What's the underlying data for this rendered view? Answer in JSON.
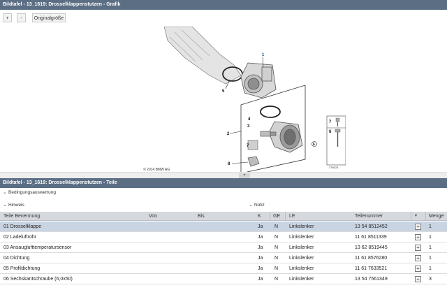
{
  "top_panel": {
    "title": "Bildtafel - 13_1619: Drosselklappenstutzen - Grafik"
  },
  "toolbar": {
    "zoom_in": "+",
    "zoom_out": "-",
    "original_size": "Originalgröße"
  },
  "figure": {
    "copyright": "© 2014 BMW AG",
    "image_number": "376023",
    "callouts": [
      "1",
      "2",
      "3",
      "4",
      "5",
      "6",
      "7",
      "8"
    ]
  },
  "bottom_panel": {
    "title": "Bildtafel - 13_1619: Drosselklappenstutzen - Teile"
  },
  "sections": {
    "conditions": "Bedingungsauswertung",
    "hint": "Hinweis",
    "note": "Notiz"
  },
  "table": {
    "headers": {
      "name": "Teile Benennung",
      "from": "Von",
      "to": "Bis",
      "k": "K",
      "ge": "GE",
      "le": "LE",
      "part_no": "Teilenummer",
      "qty": "Menge"
    },
    "rows": [
      {
        "name": "01 Drosselklappe",
        "k": "Ja",
        "ge": "N",
        "le": "Linkslenker",
        "part_no": "13 54 8512452",
        "qty": "1"
      },
      {
        "name": "02 Ladeluftrohr",
        "k": "Ja",
        "ge": "N",
        "le": "Linkslenker",
        "part_no": "11 61 8511339",
        "qty": "1"
      },
      {
        "name": "03 Ansauglufttemperatursensor",
        "k": "Ja",
        "ge": "N",
        "le": "Linkslenker",
        "part_no": "13 62 8519445",
        "qty": "1"
      },
      {
        "name": "04 Dichtung",
        "k": "Ja",
        "ge": "N",
        "le": "Linkslenker",
        "part_no": "11 61 8576280",
        "qty": "1"
      },
      {
        "name": "05 Profildichtung",
        "k": "Ja",
        "ge": "N",
        "le": "Linkslenker",
        "part_no": "11 61 7633521",
        "qty": "1"
      },
      {
        "name": "06 Sechskantschraube (6,0x50)",
        "k": "Ja",
        "ge": "N",
        "le": "Linkslenker",
        "part_no": "13 54 7561349",
        "qty": "3"
      }
    ]
  }
}
